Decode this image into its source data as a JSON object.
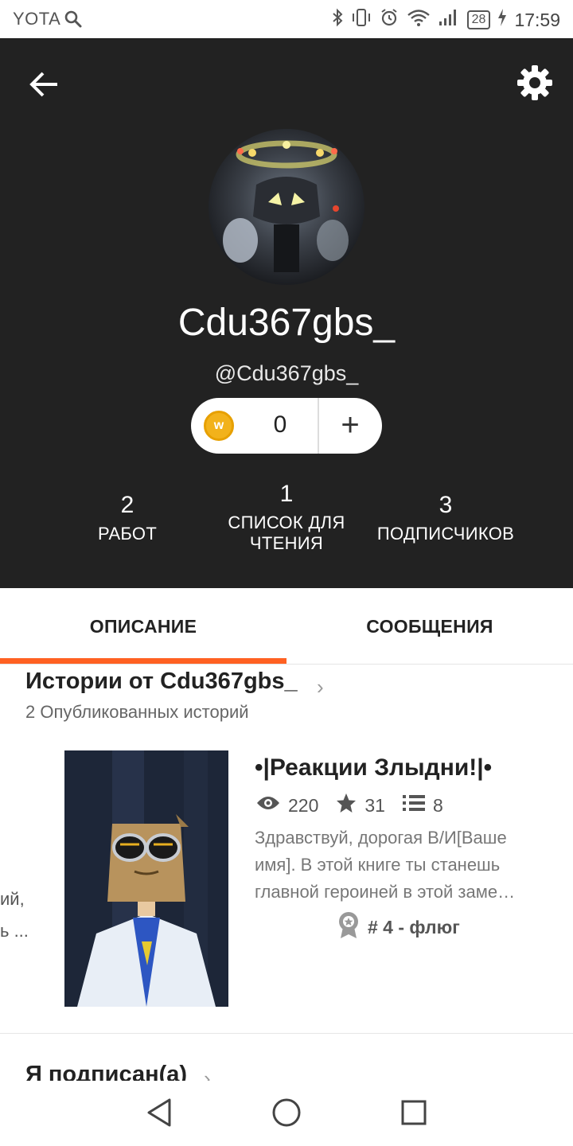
{
  "status_bar": {
    "carrier": "YOTA",
    "battery": "28",
    "time": "17:59"
  },
  "profile": {
    "display_name": "Cdu367gbs_",
    "handle": "@Cdu367gbs_",
    "coins": "0",
    "coin_letter": "w",
    "add_label": "+"
  },
  "stats": [
    {
      "num": "2",
      "label": "РАБОТ"
    },
    {
      "num": "1",
      "label": "СПИСОК ДЛЯ ЧТЕНИЯ"
    },
    {
      "num": "3",
      "label": "ПОДПИСЧИКОВ"
    }
  ],
  "tabs": [
    {
      "label": "ОПИСАНИЕ",
      "active": true
    },
    {
      "label": "СООБЩЕНИЯ",
      "active": false
    }
  ],
  "stories_section": {
    "title": "Истории от Cdu367gbs_",
    "chevron": "›",
    "subtitle": "2 Опубликованных историй"
  },
  "peek": {
    "line1": "ий,",
    "line2": "ь ..."
  },
  "story": {
    "title": "•|Реакции Злыдни!|•",
    "views": "220",
    "votes": "31",
    "parts": "8",
    "description": "Здравствуй, дорогая В/И[Ваше имя]. В этой книге ты станешь главной героиней в этой заме…",
    "rank": "# 4 - флюг"
  },
  "following_section": {
    "title": "Я подписан(а)",
    "chevron": "›"
  },
  "colors": {
    "accent": "#ff6122",
    "header_bg": "#222222",
    "coin": "#f2b21b"
  },
  "icons": [
    "search-icon",
    "bluetooth-icon",
    "vibrate-icon",
    "alarm-icon",
    "wifi-icon",
    "signal-icon",
    "charging-icon",
    "back-arrow-icon",
    "gear-icon",
    "eye-icon",
    "star-icon",
    "list-icon",
    "award-icon",
    "nav-back-icon",
    "nav-home-icon",
    "nav-recents-icon"
  ]
}
